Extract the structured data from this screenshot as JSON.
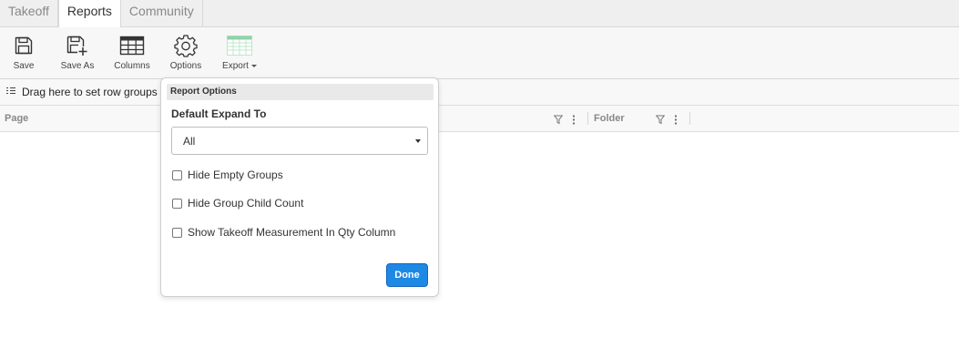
{
  "tabs": [
    {
      "label": "Takeoff",
      "active": false
    },
    {
      "label": "Reports",
      "active": true
    },
    {
      "label": "Community",
      "active": false
    }
  ],
  "toolbar": {
    "save_label": "Save",
    "save_as_label": "Save As",
    "columns_label": "Columns",
    "options_label": "Options",
    "export_label": "Export"
  },
  "groupbar": {
    "text": "Drag here to set row groups"
  },
  "columns": {
    "page": "Page",
    "folder": "Folder"
  },
  "dialog": {
    "title": "Report Options",
    "expand_label": "Default Expand To",
    "expand_value": "All",
    "options": [
      {
        "label": "Hide Empty Groups",
        "checked": false
      },
      {
        "label": "Hide Group Child Count",
        "checked": false
      },
      {
        "label": "Show Takeoff Measurement In Qty Column",
        "checked": false
      }
    ],
    "done_label": "Done"
  },
  "colors": {
    "accent": "#1e88e5",
    "export_icon": "#8fd3a8"
  }
}
